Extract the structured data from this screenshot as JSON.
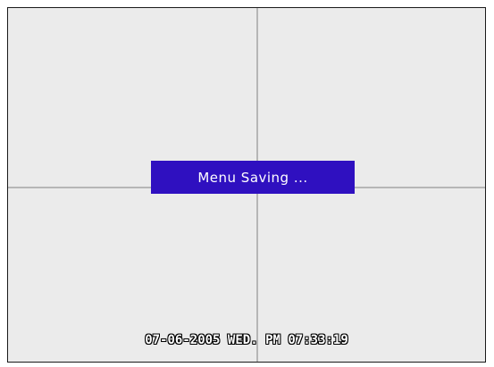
{
  "dialog": {
    "message": "Menu Saving ..."
  },
  "overlay": {
    "datetime": "07-06-2005 WED. PM 07:33:19"
  },
  "colors": {
    "dialog_background": "#2f10c0",
    "screen_background": "#ebebeb",
    "gridline": "#b6b6b6",
    "text": "#ffffff"
  }
}
